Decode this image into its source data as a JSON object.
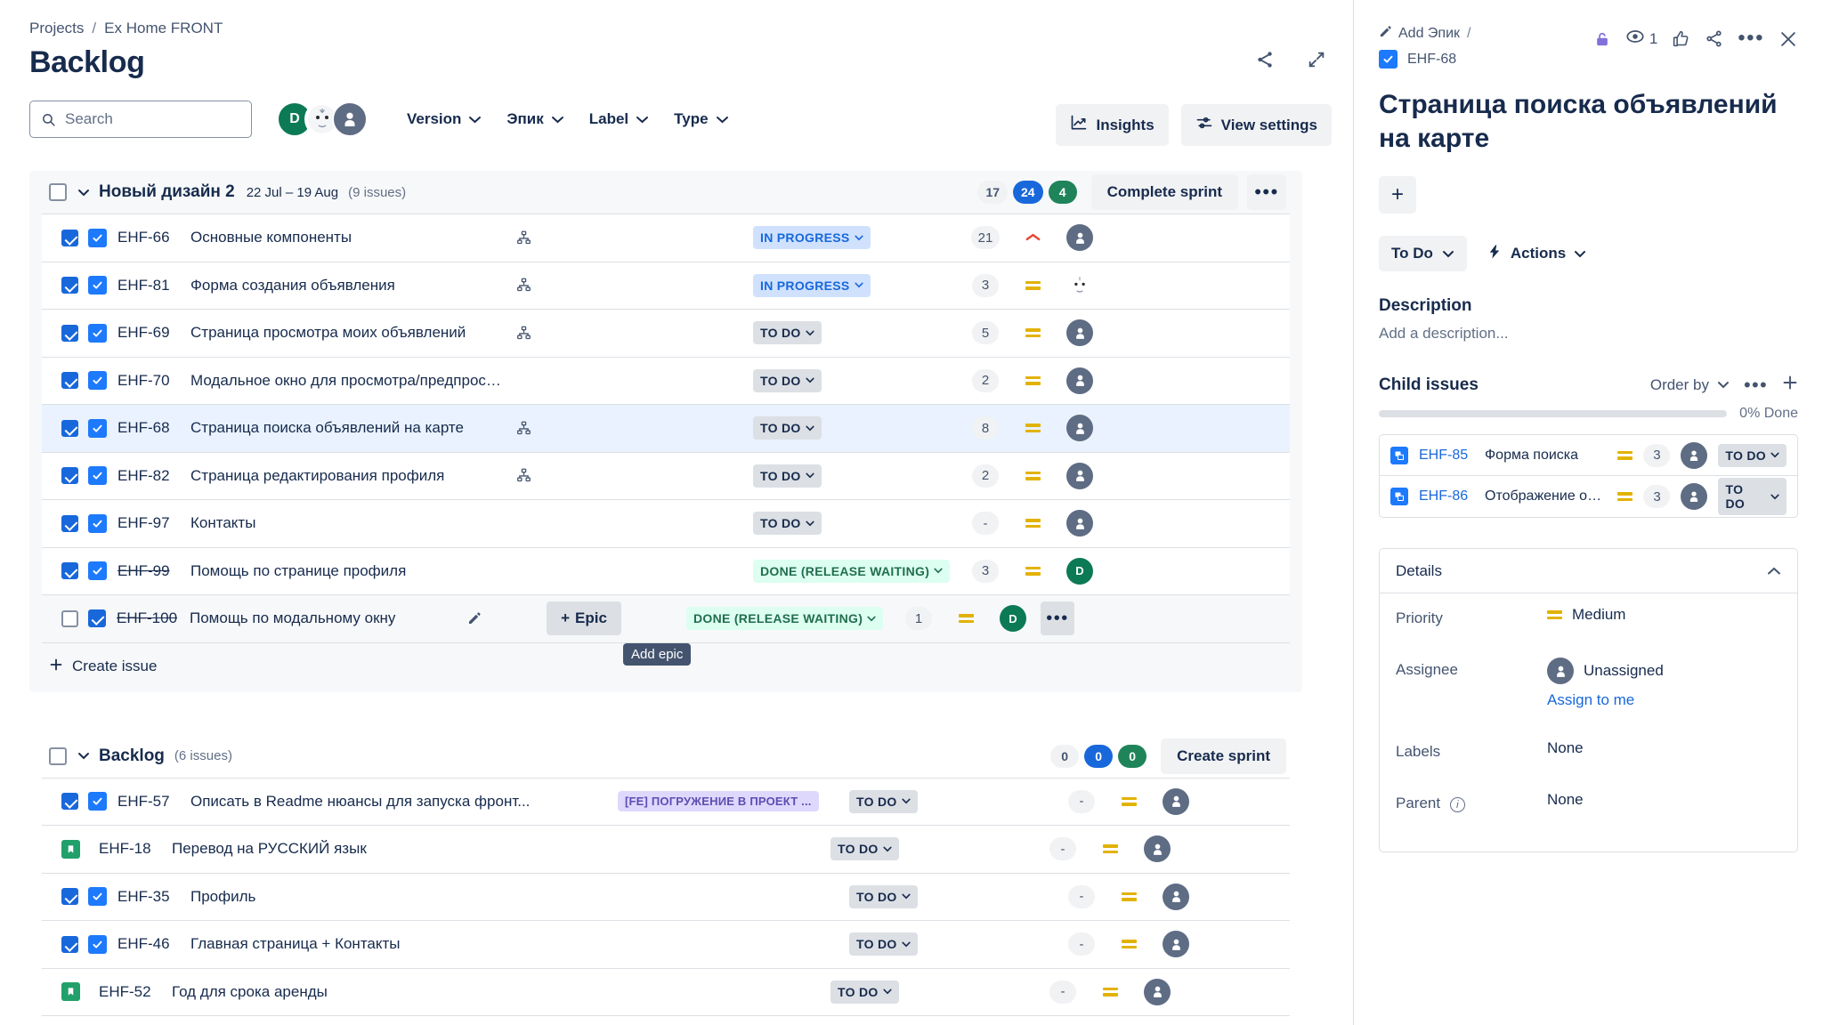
{
  "breadcrumb": {
    "projects": "Projects",
    "separator": "/",
    "project": "Ex Home FRONT"
  },
  "header": {
    "title": "Backlog",
    "share_icon": "share-icon",
    "expand_icon": "expand-icon"
  },
  "toolbar": {
    "search": {
      "placeholder": "Search",
      "value": "",
      "icon": "search-icon"
    },
    "avatars": [
      {
        "name": "avatar-d",
        "initial": "D",
        "color": "#0c7a54"
      },
      {
        "name": "avatar-face",
        "initial": "",
        "color": "#ffffff"
      },
      {
        "name": "avatar-generic",
        "initial": "",
        "color": "#5e6c84"
      }
    ],
    "filters": [
      {
        "label": "Version"
      },
      {
        "label": "Эпик"
      },
      {
        "label": "Label"
      },
      {
        "label": "Type"
      }
    ],
    "insights_label": "Insights",
    "insights_icon": "insights-chart-icon",
    "view_settings_label": "View settings",
    "view_settings_icon": "sliders-icon"
  },
  "sprint": {
    "name": "Новый дизайн 2",
    "dates": "22 Jul – 19 Aug",
    "issue_count": "(9 issues)",
    "badges": {
      "grey": "17",
      "blue": "24",
      "green": "4"
    },
    "complete_label": "Complete sprint",
    "more_label": "•••",
    "create_issue_label": "Create issue",
    "issues": [
      {
        "key": "EHF-66",
        "summary": "Основные компоненты",
        "type": "task",
        "has_tree": true,
        "status": "IN PROGRESS",
        "status_kind": "inprogress",
        "points": "21",
        "priority": "high",
        "assignee": "unassigned",
        "done": false
      },
      {
        "key": "EHF-81",
        "summary": "Форма создания объявления",
        "type": "task",
        "has_tree": true,
        "status": "IN PROGRESS",
        "status_kind": "inprogress",
        "points": "3",
        "priority": "medium",
        "assignee": "face",
        "done": false
      },
      {
        "key": "EHF-69",
        "summary": "Страница просмотра моих объявлений",
        "type": "task",
        "has_tree": true,
        "status": "TO DO",
        "status_kind": "todo",
        "points": "5",
        "priority": "medium",
        "assignee": "unassigned",
        "done": false
      },
      {
        "key": "EHF-70",
        "summary": "Модальное окно для просмотра/предпросмот...",
        "type": "task",
        "has_tree": false,
        "status": "TO DO",
        "status_kind": "todo",
        "points": "2",
        "priority": "medium",
        "assignee": "unassigned",
        "done": false
      },
      {
        "key": "EHF-68",
        "summary": "Страница поиска объявлений на карте",
        "type": "task",
        "has_tree": true,
        "status": "TO DO",
        "status_kind": "todo",
        "points": "8",
        "priority": "medium",
        "assignee": "unassigned",
        "done": false,
        "selected": true
      },
      {
        "key": "EHF-82",
        "summary": "Страница редактирования профиля",
        "type": "task",
        "has_tree": true,
        "status": "TO DO",
        "status_kind": "todo",
        "points": "2",
        "priority": "medium",
        "assignee": "unassigned",
        "done": false
      },
      {
        "key": "EHF-97",
        "summary": "Контакты",
        "type": "task",
        "has_tree": false,
        "status": "TO DO",
        "status_kind": "todo",
        "points": "-",
        "priority": "medium",
        "assignee": "unassigned",
        "done": false
      },
      {
        "key": "EHF-99",
        "summary": "Помощь по странице профиля",
        "type": "task",
        "has_tree": false,
        "status": "DONE (RELEASE WAITING)",
        "status_kind": "done",
        "points": "3",
        "priority": "medium",
        "assignee": "dgreen",
        "done": true
      },
      {
        "key": "EHF-100",
        "summary": "Помощь по модальному окну",
        "type": "task",
        "has_tree": false,
        "status": "DONE (RELEASE WAITING)",
        "status_kind": "done",
        "points": "1",
        "priority": "medium",
        "assignee": "dgreen",
        "done": true,
        "hovered": true,
        "epic_add_label": "Epic",
        "tooltip": "Add epic"
      }
    ]
  },
  "backlog": {
    "name": "Backlog",
    "issue_count": "(6 issues)",
    "badges": {
      "grey": "0",
      "blue": "0",
      "green": "0"
    },
    "create_sprint_label": "Create sprint",
    "issues": [
      {
        "key": "EHF-57",
        "summary": "Описать в Readme нюансы для запуска фронт...",
        "type": "task",
        "epic": "[FE] ПОГРУЖЕНИЕ В ПРОЕКТ ...",
        "status": "TO DO",
        "status_kind": "todo",
        "points": "-",
        "priority": "medium",
        "assignee": "unassigned"
      },
      {
        "key": "EHF-18",
        "summary": "Перевод на РУССКИЙ язык",
        "type": "story",
        "epic": "",
        "status": "TO DO",
        "status_kind": "todo",
        "points": "-",
        "priority": "medium",
        "assignee": "unassigned"
      },
      {
        "key": "EHF-35",
        "summary": "Профиль",
        "type": "task",
        "epic": "",
        "status": "TO DO",
        "status_kind": "todo",
        "points": "-",
        "priority": "medium",
        "assignee": "unassigned"
      },
      {
        "key": "EHF-46",
        "summary": "Главная страница + Контакты",
        "type": "task",
        "epic": "",
        "status": "TO DO",
        "status_kind": "todo",
        "points": "-",
        "priority": "medium",
        "assignee": "unassigned"
      },
      {
        "key": "EHF-52",
        "summary": "Год для срока аренды",
        "type": "story",
        "epic": "",
        "status": "TO DO",
        "status_kind": "todo",
        "points": "-",
        "priority": "medium",
        "assignee": "unassigned"
      }
    ]
  },
  "detail": {
    "add_epic_label": "Add Эпик",
    "separator": "/",
    "issue_key": "EHF-68",
    "lock_icon": "unlocked-padlock-icon",
    "watch_count": "1",
    "watch_icon": "eye-icon",
    "like_icon": "thumbs-up-icon",
    "share_icon": "share-icon",
    "more_icon": "more-horizontal-icon",
    "close_icon": "close-icon",
    "title": "Страница поиска объявлений на карте",
    "add_button_label": "+",
    "status": "To Do",
    "actions_label": "Actions",
    "actions_icon": "lightning-bolt-icon",
    "description_heading": "Description",
    "description_placeholder": "Add a description...",
    "child_issues": {
      "heading": "Child issues",
      "order_by_label": "Order by",
      "more_icon": "more-horizontal-icon",
      "add_icon": "plus-icon",
      "progress_text": "0% Done",
      "progress_percent": 0,
      "items": [
        {
          "key": "EHF-85",
          "summary": "Форма поиска",
          "priority": "medium",
          "points": "3",
          "assignee": "unassigned",
          "status": "TO DO"
        },
        {
          "key": "EHF-86",
          "summary": "Отображение об...",
          "priority": "medium",
          "points": "3",
          "assignee": "unassigned",
          "status": "TO DO"
        }
      ]
    },
    "details": {
      "heading": "Details",
      "collapse_icon": "chevron-up-icon",
      "fields": [
        {
          "label": "Priority",
          "value": "Medium",
          "kind": "priority"
        },
        {
          "label": "Assignee",
          "value": "Unassigned",
          "kind": "assignee",
          "link": "Assign to me"
        },
        {
          "label": "Labels",
          "value": "None",
          "kind": "text"
        },
        {
          "label": "Parent",
          "value": "None",
          "kind": "text",
          "info": true
        }
      ]
    }
  },
  "colors": {
    "accent_blue": "#1868db",
    "task_blue": "#1d7afc",
    "story_green": "#22a06b",
    "epic_purple": "#5e4db2",
    "epic_purple_bg": "#dfd8fd",
    "done_green_bg": "#dcfff1",
    "priority_yellow": "#e2b203",
    "priority_red": "#e34935"
  }
}
